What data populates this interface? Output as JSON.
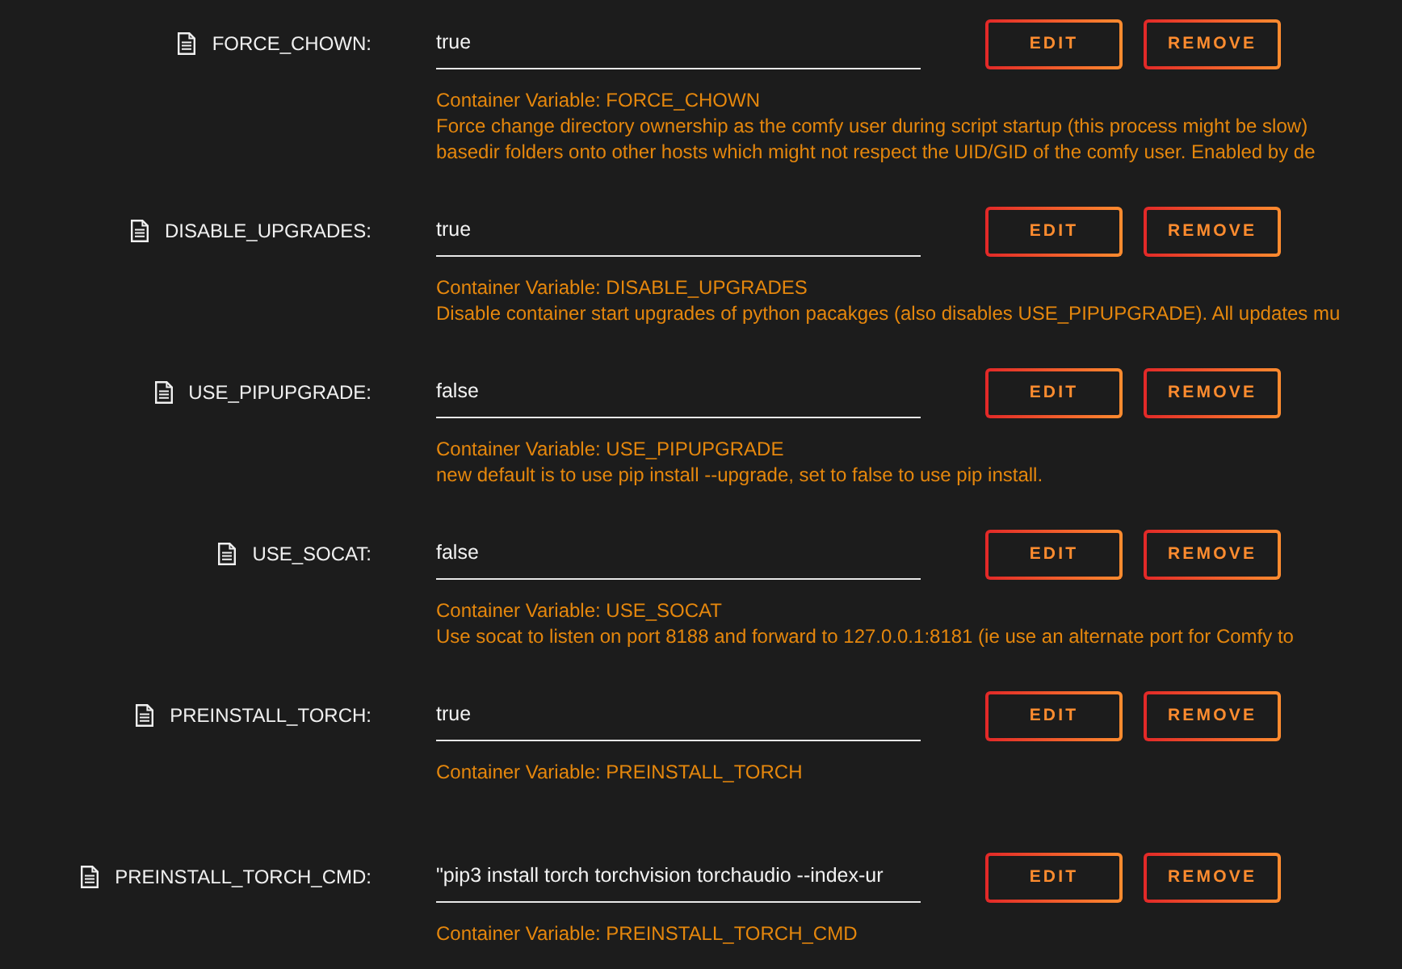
{
  "variables": [
    {
      "name": "FORCE_CHOWN:",
      "value": "true",
      "buttons": [
        "EDIT",
        "REMOVE"
      ],
      "caption": "Container Variable: FORCE_CHOWN",
      "description_lines": [
        "Force change directory ownership as the comfy user during script startup (this process might be slow)",
        "basedir folders onto other hosts which might not respect the UID/GID of the comfy user. Enabled by de"
      ]
    },
    {
      "name": "DISABLE_UPGRADES:",
      "value": "true",
      "buttons": [
        "EDIT",
        "REMOVE"
      ],
      "caption": "Container Variable: DISABLE_UPGRADES",
      "description_lines": [
        "Disable container start upgrades of python pacakges (also disables USE_PIPUPGRADE). All updates mu"
      ]
    },
    {
      "name": "USE_PIPUPGRADE:",
      "value": "false",
      "buttons": [
        "EDIT",
        "REMOVE"
      ],
      "caption": "Container Variable: USE_PIPUPGRADE",
      "description_lines": [
        "new default is to use pip install --upgrade, set to false to use pip install."
      ]
    },
    {
      "name": "USE_SOCAT:",
      "value": "false",
      "buttons": [
        "EDIT",
        "REMOVE"
      ],
      "caption": "Container Variable: USE_SOCAT",
      "description_lines": [
        "Use socat to listen on port 8188 and forward to 127.0.0.1:8181 (ie use an alternate port for Comfy to"
      ]
    },
    {
      "name": "PREINSTALL_TORCH:",
      "value": "true",
      "buttons": [
        "EDIT",
        "REMOVE"
      ],
      "caption": "Container Variable: PREINSTALL_TORCH"
    },
    {
      "name": "PREINSTALL_TORCH_CMD:",
      "value": "\"pip3 install torch torchvision torchaudio --index-ur",
      "buttons": [
        "EDIT",
        "REMOVE"
      ],
      "caption": "Container Variable: PREINSTALL_TORCH_CMD"
    }
  ]
}
